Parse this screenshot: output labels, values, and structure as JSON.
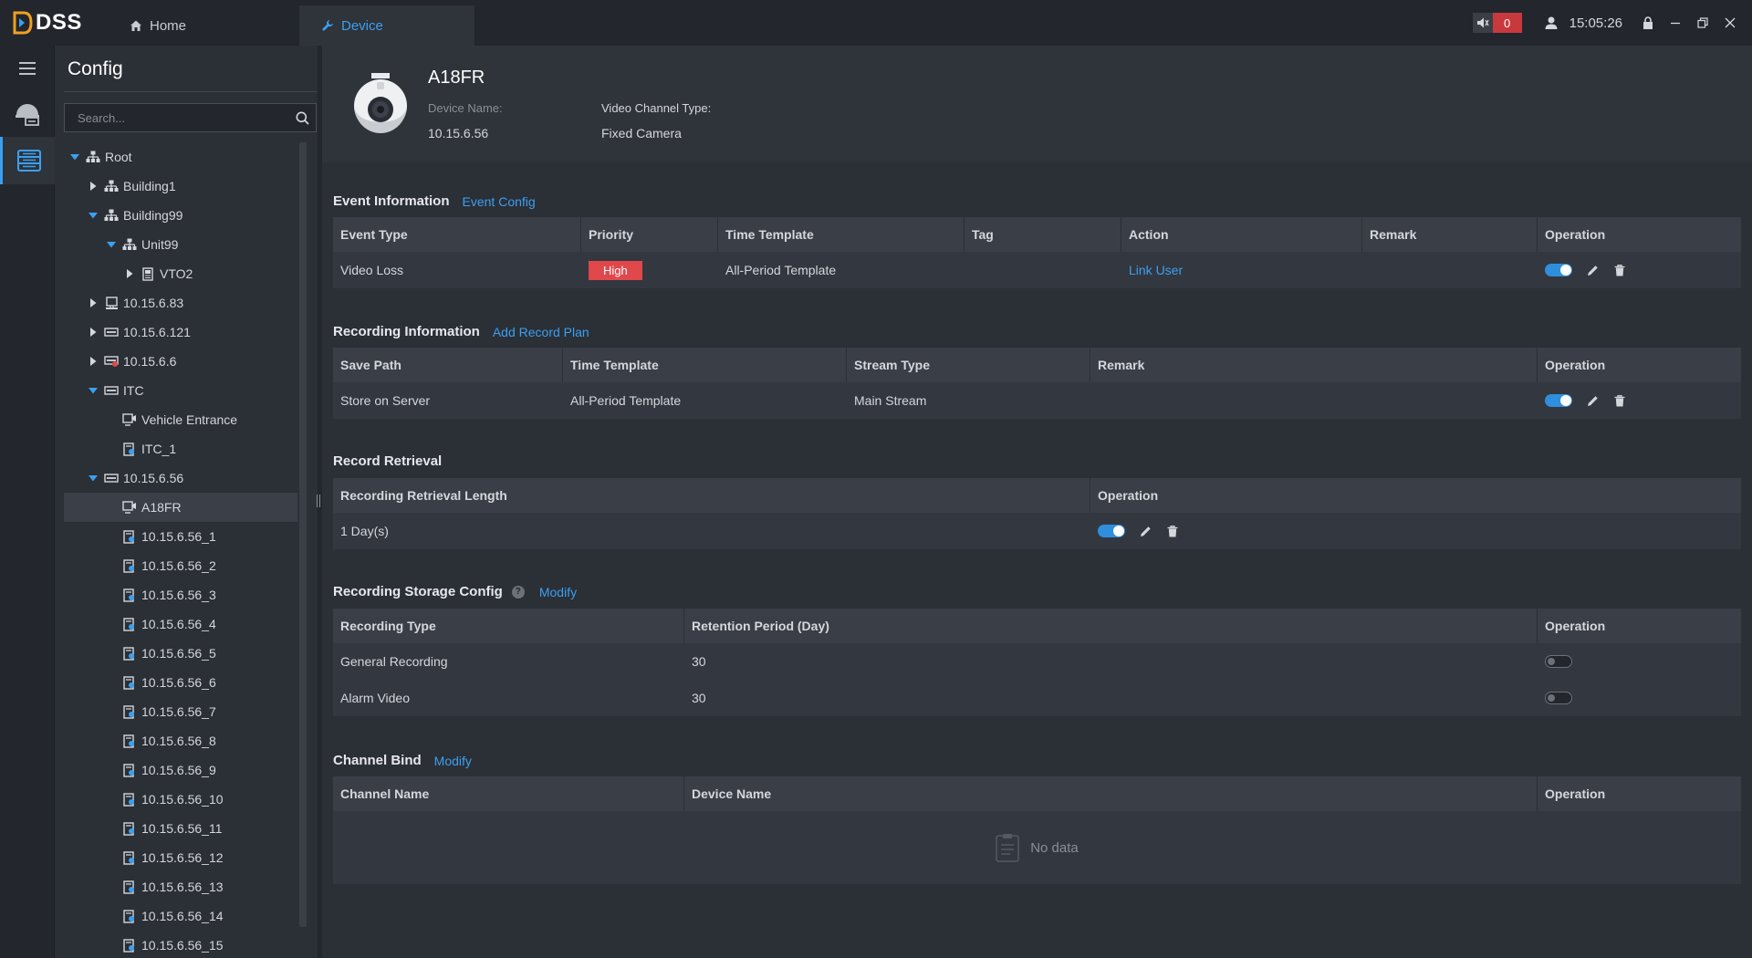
{
  "app": {
    "logo_text": "DSS",
    "tabs": [
      {
        "label": "Home",
        "icon": "home-icon"
      },
      {
        "label": "Device",
        "icon": "wrench-icon"
      }
    ],
    "alarm_count": "0",
    "time": "15:05:26"
  },
  "config": {
    "title": "Config",
    "search_placeholder": "Search...",
    "tree": [
      {
        "label": "Root",
        "level": 0,
        "expanded": true,
        "icon": "org-icon"
      },
      {
        "label": "Building1",
        "level": 1,
        "expanded": false,
        "icon": "org-icon"
      },
      {
        "label": "Building99",
        "level": 1,
        "expanded": true,
        "icon": "org-icon"
      },
      {
        "label": "Unit99",
        "level": 2,
        "expanded": true,
        "icon": "org-icon"
      },
      {
        "label": "VTO2",
        "level": 3,
        "expanded": false,
        "icon": "vto-icon"
      },
      {
        "label": "10.15.6.83",
        "level": 1,
        "expanded": false,
        "icon": "pc-icon"
      },
      {
        "label": "10.15.6.121",
        "level": 1,
        "expanded": false,
        "icon": "nvr-icon"
      },
      {
        "label": "10.15.6.6",
        "level": 1,
        "expanded": false,
        "icon": "nvr-alert-icon"
      },
      {
        "label": "ITC",
        "level": 1,
        "expanded": true,
        "icon": "nvr-icon"
      },
      {
        "label": "Vehicle Entrance",
        "level": 2,
        "icon": "camera-channel-icon"
      },
      {
        "label": "ITC_1",
        "level": 2,
        "icon": "channel-icon"
      },
      {
        "label": "10.15.6.56",
        "level": 1,
        "expanded": true,
        "icon": "nvr-icon"
      },
      {
        "label": "A18FR",
        "level": 2,
        "icon": "camera-channel-icon",
        "selected": true
      },
      {
        "label": "10.15.6.56_1",
        "level": 2,
        "icon": "channel-icon"
      },
      {
        "label": "10.15.6.56_2",
        "level": 2,
        "icon": "channel-icon"
      },
      {
        "label": "10.15.6.56_3",
        "level": 2,
        "icon": "channel-icon"
      },
      {
        "label": "10.15.6.56_4",
        "level": 2,
        "icon": "channel-icon"
      },
      {
        "label": "10.15.6.56_5",
        "level": 2,
        "icon": "channel-icon"
      },
      {
        "label": "10.15.6.56_6",
        "level": 2,
        "icon": "channel-icon"
      },
      {
        "label": "10.15.6.56_7",
        "level": 2,
        "icon": "channel-icon"
      },
      {
        "label": "10.15.6.56_8",
        "level": 2,
        "icon": "channel-icon"
      },
      {
        "label": "10.15.6.56_9",
        "level": 2,
        "icon": "channel-icon"
      },
      {
        "label": "10.15.6.56_10",
        "level": 2,
        "icon": "channel-icon"
      },
      {
        "label": "10.15.6.56_11",
        "level": 2,
        "icon": "channel-icon"
      },
      {
        "label": "10.15.6.56_12",
        "level": 2,
        "icon": "channel-icon"
      },
      {
        "label": "10.15.6.56_13",
        "level": 2,
        "icon": "channel-icon"
      },
      {
        "label": "10.15.6.56_14",
        "level": 2,
        "icon": "channel-icon"
      },
      {
        "label": "10.15.6.56_15",
        "level": 2,
        "icon": "channel-icon"
      }
    ]
  },
  "device": {
    "name": "A18FR",
    "device_name_label": "Device Name:",
    "device_name_value": "10.15.6.56",
    "channel_type_label": "Video Channel Type:",
    "channel_type_value": "Fixed Camera"
  },
  "event_info": {
    "title": "Event Information",
    "link": "Event Config",
    "headers": [
      "Event Type",
      "Priority",
      "Time Template",
      "Tag",
      "Action",
      "Remark",
      "Operation"
    ],
    "rows": [
      {
        "event_type": "Video Loss",
        "priority": "High",
        "time_template": "All-Period Template",
        "tag": "",
        "action": "Link User",
        "remark": "",
        "enabled": true
      }
    ]
  },
  "recording_info": {
    "title": "Recording Information",
    "link": "Add Record Plan",
    "headers": [
      "Save Path",
      "Time Template",
      "Stream Type",
      "Remark",
      "Operation"
    ],
    "rows": [
      {
        "save_path": "Store on Server",
        "time_template": "All-Period Template",
        "stream_type": "Main Stream",
        "remark": "",
        "enabled": true
      }
    ]
  },
  "record_retrieval": {
    "title": "Record Retrieval",
    "headers": [
      "Recording Retrieval Length",
      "Operation"
    ],
    "rows": [
      {
        "length": "1 Day(s)",
        "enabled": true
      }
    ]
  },
  "storage_config": {
    "title": "Recording Storage Config",
    "link": "Modify",
    "headers": [
      "Recording Type",
      "Retention Period (Day)",
      "Operation"
    ],
    "rows": [
      {
        "type": "General Recording",
        "retention": "30",
        "enabled": false
      },
      {
        "type": "Alarm Video",
        "retention": "30",
        "enabled": false
      }
    ]
  },
  "channel_bind": {
    "title": "Channel Bind",
    "link": "Modify",
    "headers": [
      "Channel Name",
      "Device Name",
      "Operation"
    ],
    "empty_text": "No data"
  },
  "colors": {
    "accent": "#3ba0f0",
    "danger": "#e0484b",
    "background": "#2b2f36"
  }
}
